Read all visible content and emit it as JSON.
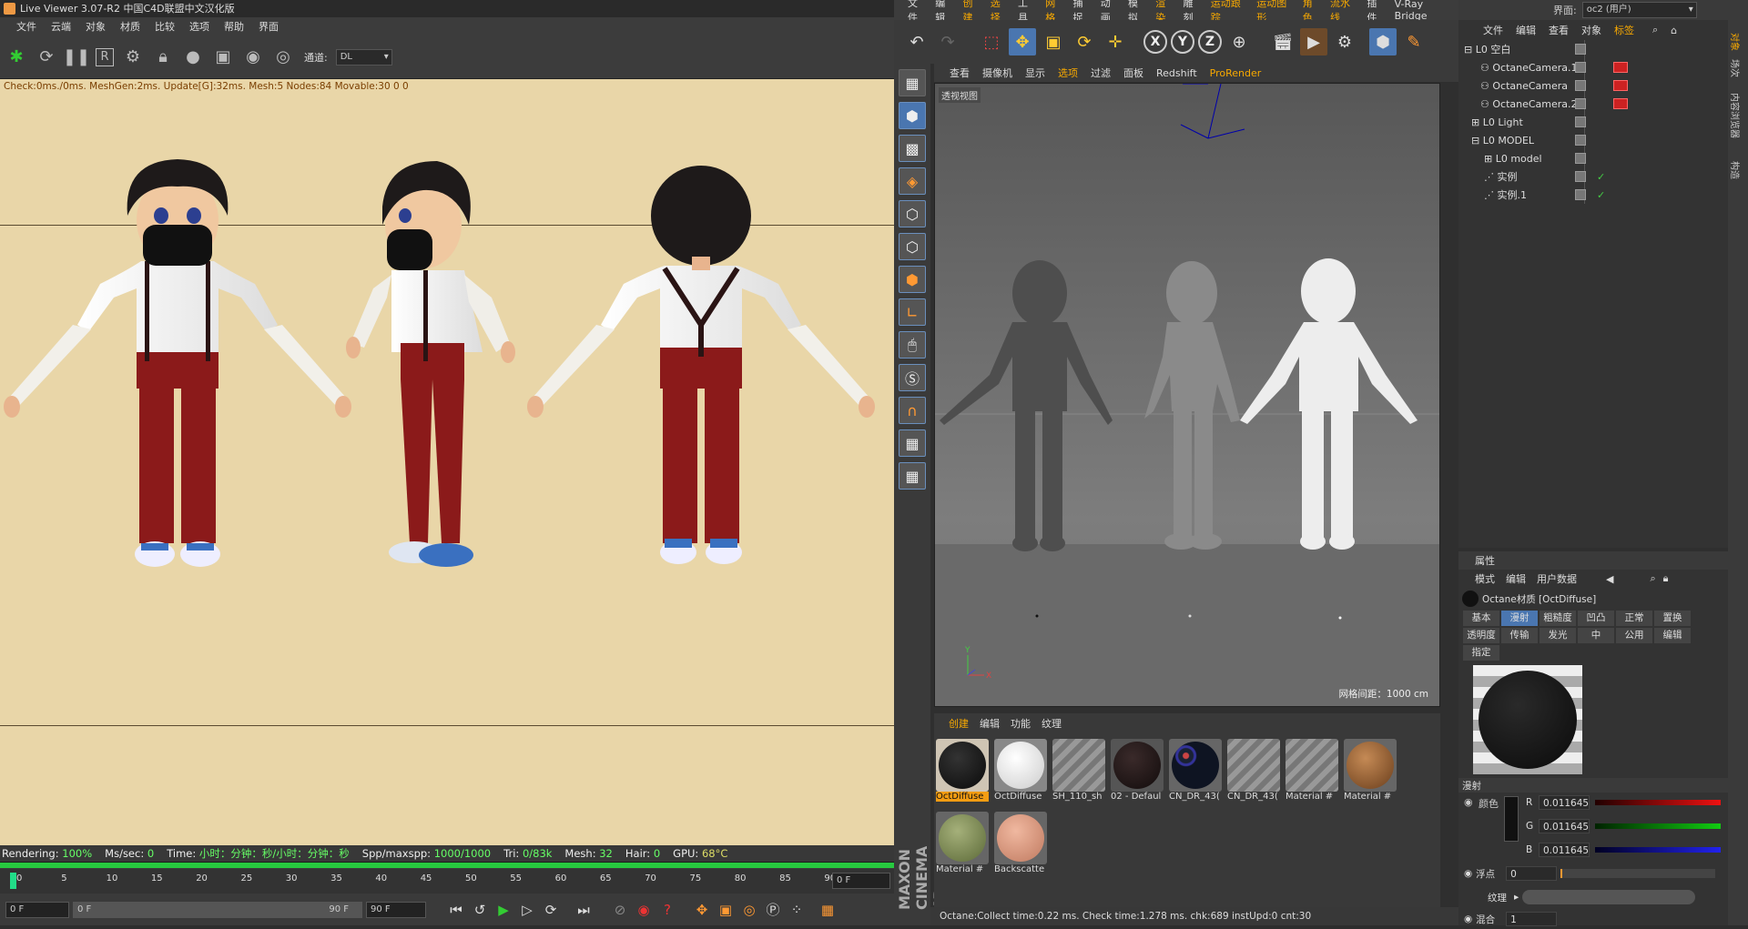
{
  "live_viewer": {
    "title": "Live Viewer 3.07-R2 中国C4D联盟中文汉化版",
    "menu": [
      "文件",
      "云端",
      "对象",
      "材质",
      "比较",
      "选项",
      "帮助",
      "界面"
    ],
    "channel_label": "通道:",
    "channel_value": "DL",
    "check_text": "Check:0ms./0ms. MeshGen:2ms. Update[G]:32ms. Mesh:5 Nodes:84 Movable:30  0 0",
    "status": {
      "rendering_label": "Rendering:",
      "rendering": "100%",
      "mssec_label": "Ms/sec:",
      "mssec": "0",
      "time_label": "Time:",
      "time": "小时：分钟：秒/小时：分钟：秒",
      "spp_label": "Spp/maxspp:",
      "spp": "1000/1000",
      "tri_label": "Tri:",
      "tri": "0/83k",
      "mesh_label": "Mesh:",
      "mesh": "32",
      "hair_label": "Hair:",
      "hair": "0",
      "gpu_label": "GPU:",
      "gpu_temp": "68°C"
    },
    "ruler": [
      "0",
      "5",
      "10",
      "15",
      "20",
      "25",
      "30",
      "35",
      "40",
      "45",
      "50",
      "55",
      "60",
      "65",
      "70",
      "75",
      "80",
      "85",
      "90"
    ],
    "frame_field": "0 F",
    "bottom": {
      "start": "0 F",
      "range_start": "0 F",
      "range_end": "90 F",
      "end": "90 F"
    }
  },
  "c4d": {
    "menu": [
      "文件",
      "编辑",
      "创建",
      "选择",
      "工具",
      "网格",
      "捕捉",
      "动画",
      "模拟",
      "渲染",
      "雕刻",
      "运动跟踪",
      "运动图形",
      "角色",
      "流水线",
      "插件",
      "V-Ray Bridge"
    ],
    "menu_highlight": [
      "创建",
      "选择",
      "网格",
      "渲染",
      "运动跟踪",
      "运动图形",
      "角色",
      "流水线"
    ],
    "interface_label": "界面:",
    "interface_value": "oc2 (用户)",
    "viewport_menu": [
      "查看",
      "摄像机",
      "显示",
      "选项",
      "过滤",
      "面板",
      "Redshift",
      "ProRender"
    ],
    "viewport_label": "透视视图",
    "grid_spacing": "网格间距：1000 cm",
    "material_menu": [
      "创建",
      "编辑",
      "功能",
      "纹理"
    ],
    "materials": [
      {
        "label": "OctDiffuse",
        "selected": true
      },
      {
        "label": "OctDiffuse"
      },
      {
        "label": "SH_110_sh"
      },
      {
        "label": "02 - Defaul"
      },
      {
        "label": "CN_DR_43("
      },
      {
        "label": "CN_DR_43("
      },
      {
        "label": "Material #"
      },
      {
        "label": "Material #"
      },
      {
        "label": "Material #"
      },
      {
        "label": "Backscatte"
      }
    ],
    "status": "Octane:Collect time:0.22 ms.  Check time:1.278 ms.  chk:689  instUpd:0  cnt:30",
    "maxon": "MAXON CINEMA 4D"
  },
  "object_manager": {
    "menu": [
      "文件",
      "编辑",
      "查看",
      "对象",
      "标签"
    ],
    "objects": [
      {
        "name": "空白",
        "indent": 0
      },
      {
        "name": "OctaneCamera.1",
        "indent": 1,
        "cam": true
      },
      {
        "name": "OctaneCamera",
        "indent": 1,
        "cam": true
      },
      {
        "name": "OctaneCamera.2",
        "indent": 1,
        "cam": true
      },
      {
        "name": "Light",
        "indent": 0
      },
      {
        "name": "MODEL",
        "indent": 0
      },
      {
        "name": "model",
        "indent": 1
      },
      {
        "name": "实例",
        "indent": 1
      },
      {
        "name": "实例.1",
        "indent": 1
      }
    ],
    "side_tabs": [
      "对象",
      "场次",
      "内容浏览器",
      "构造"
    ]
  },
  "attributes": {
    "title": "属性",
    "menu": [
      "模式",
      "编辑",
      "用户数据"
    ],
    "material_name": "Octane材质 [OctDiffuse]",
    "tabs": [
      "基本",
      "漫射",
      "粗糙度",
      "凹凸",
      "正常",
      "置换",
      "透明度",
      "传输",
      "发光",
      "中",
      "公用",
      "编辑",
      "指定"
    ],
    "selected_tab": "漫射",
    "section": "漫射",
    "color_label": "颜色",
    "r_label": "R",
    "g_label": "G",
    "b_label": "B",
    "r": "0.011645",
    "g": "0.011645",
    "b": "0.011645",
    "float_label": "浮点",
    "float_value": "0",
    "texture_label": "纹理",
    "mix_label": "混合",
    "mix_value": "1"
  }
}
